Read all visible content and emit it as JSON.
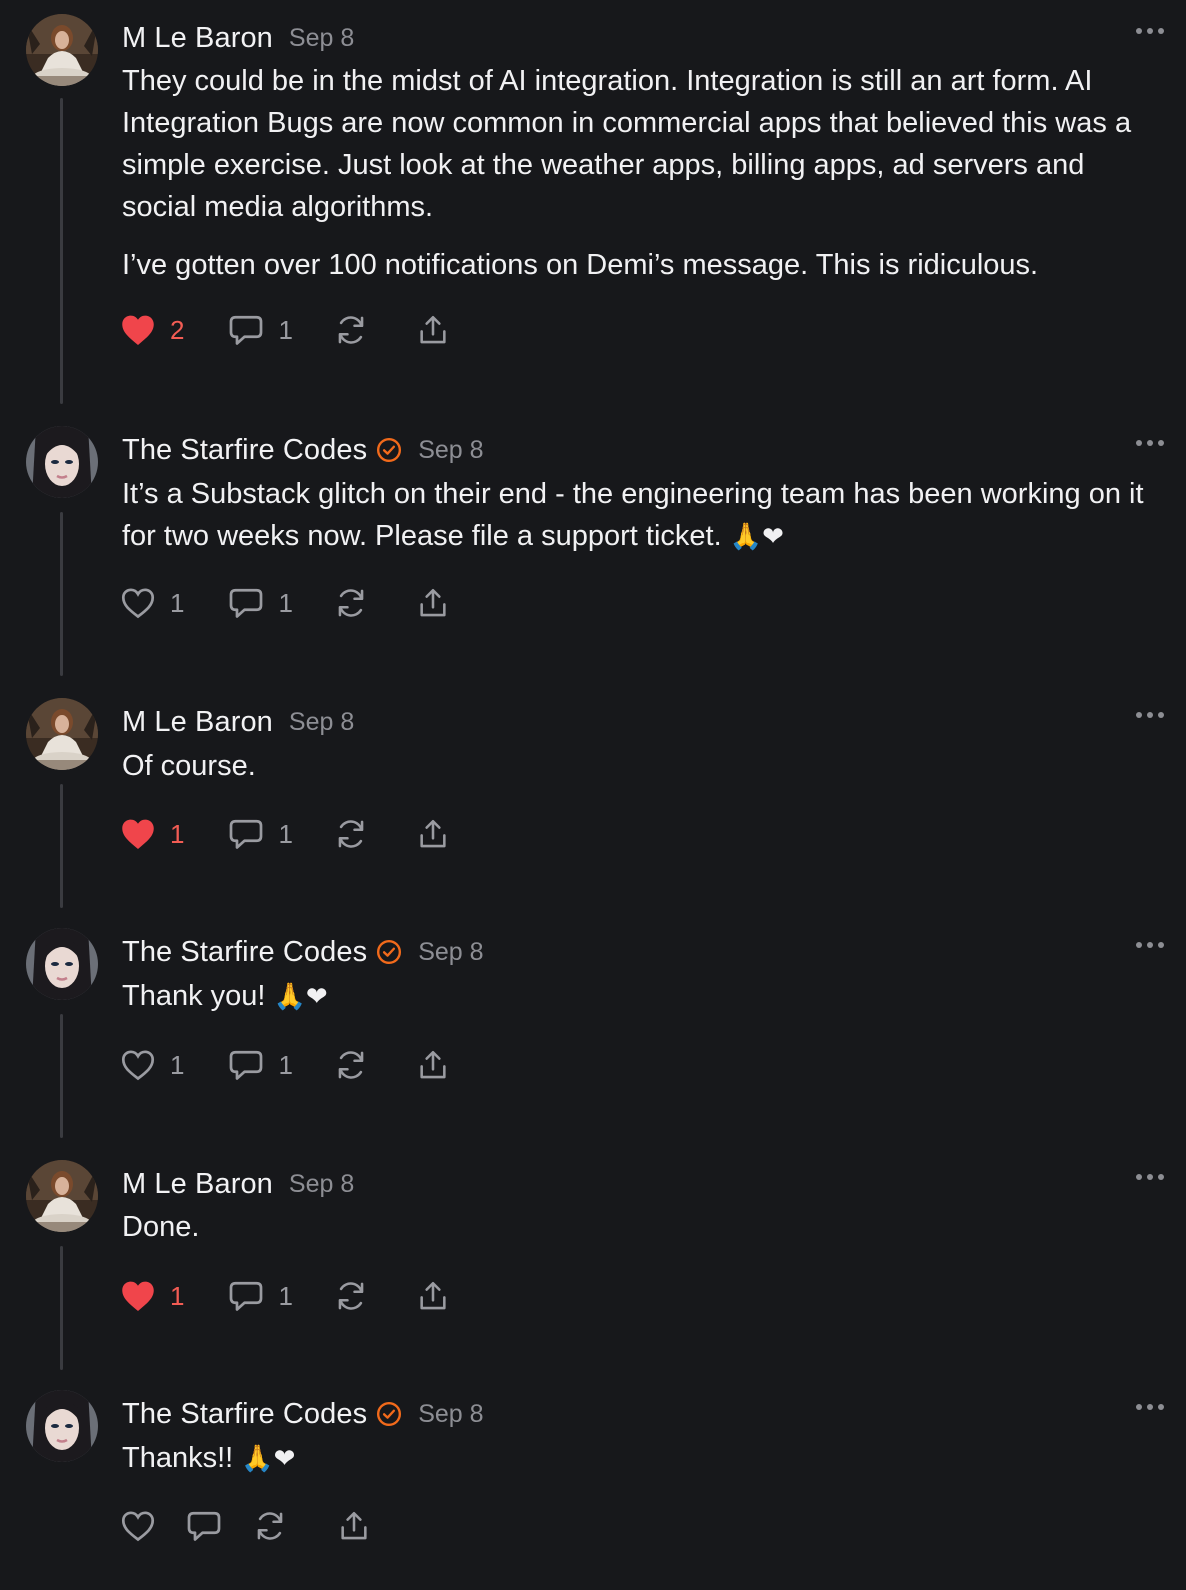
{
  "colors": {
    "background": "#17181b",
    "like": "#f0454b",
    "verified": "#f26a1b",
    "muted": "#9a9ba1"
  },
  "comments": [
    {
      "author": "M Le Baron",
      "date": "Sep 8",
      "verified": false,
      "avatar": "m-le-baron",
      "paragraphs": [
        "They could be in the midst of AI integration. Integration is still an art form. AI Integration Bugs are now common in commercial apps that believed this was a simple exercise. Just look at the weather apps, billing apps, ad servers and social media algorithms.",
        "I’ve gotten over 100 notifications on Demi’s message. This is ridiculous."
      ],
      "likes": "2",
      "liked": true,
      "replies": "1"
    },
    {
      "author": "The Starfire Codes",
      "date": "Sep 8",
      "verified": true,
      "avatar": "starfire-codes",
      "text": "It’s a Substack glitch on their end - the engineering team has been working on it for two weeks now. Please file a support ticket.",
      "emoji": "🙏❤",
      "likes": "1",
      "liked": false,
      "replies": "1"
    },
    {
      "author": "M Le Baron",
      "date": "Sep 8",
      "verified": false,
      "avatar": "m-le-baron",
      "text": "Of course.",
      "likes": "1",
      "liked": true,
      "replies": "1"
    },
    {
      "author": "The Starfire Codes",
      "date": "Sep 8",
      "verified": true,
      "avatar": "starfire-codes",
      "text": "Thank you!",
      "emoji": "🙏❤",
      "likes": "1",
      "liked": false,
      "replies": "1"
    },
    {
      "author": "M Le Baron",
      "date": "Sep 8",
      "verified": false,
      "avatar": "m-le-baron",
      "text": "Done.",
      "likes": "1",
      "liked": true,
      "replies": "1"
    },
    {
      "author": "The Starfire Codes",
      "date": "Sep 8",
      "verified": true,
      "avatar": "starfire-codes",
      "text": "Thanks!!",
      "emoji": "🙏❤",
      "likes": "",
      "liked": false,
      "replies": ""
    }
  ]
}
